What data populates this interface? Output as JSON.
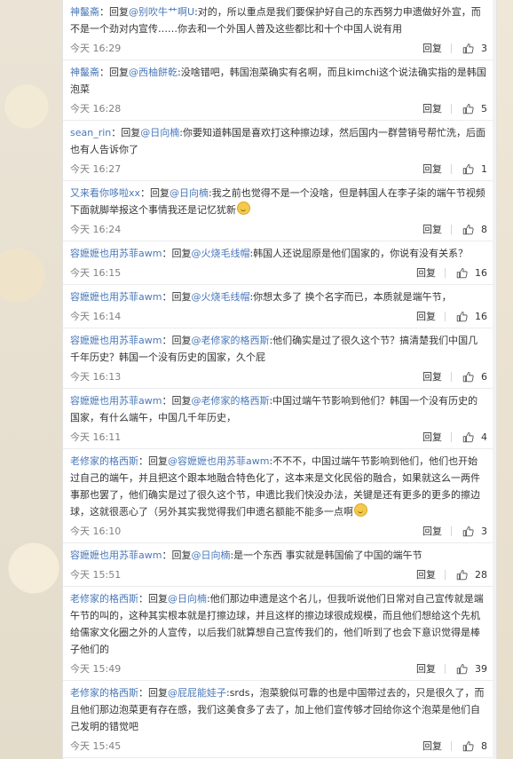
{
  "colors": {
    "username": "#4a78b8",
    "text": "#333333",
    "time": "#808080",
    "background": "#e9e4da"
  },
  "reply_label": "回复",
  "like_icon": "thumbs-up-icon",
  "comments": [
    {
      "user": "神鬣斋",
      "prefix": "：回复",
      "mention": "@别吹牛艹啊U",
      "text": ":对的，所以重点是我们要保护好自己的东西努力申遗做好外宣，而不是一个劲对内宣传……你去和一个外国人普及这些都比和十个中国人说有用",
      "time": "今天 16:29",
      "likes": "3"
    },
    {
      "user": "神鬣斋",
      "prefix": "：回复",
      "mention": "@西柚餅乾",
      "text": ":没啥错吧，韩国泡菜确实有名啊，而且kimchi这个说法确实指的是韩国泡菜",
      "time": "今天 16:28",
      "likes": "5"
    },
    {
      "user": "sean_rin",
      "prefix": "：回复",
      "mention": "@日向楠",
      "text": ":你要知道韩国是喜欢打这种擦边球，然后国内一群营销号帮忙洗，后面也有人告诉你了",
      "time": "今天 16:27",
      "likes": "1"
    },
    {
      "user": "又来看你哆啦xx",
      "prefix": "：回复",
      "mention": "@日向楠",
      "text": ":我之前也觉得不是一个没啥，但是韩国人在李子柒的端午节视频下面就脚举报这个事情我还是记忆犹新",
      "emoji": true,
      "time": "今天 16:24",
      "likes": "8"
    },
    {
      "user": "容嬷嬷也用苏菲awm",
      "prefix": "：回复",
      "mention": "@火烧毛线帽",
      "text": ":韩国人还说屈原是他们国家的，你说有没有关系？",
      "time": "今天 16:15",
      "likes": "16"
    },
    {
      "user": "容嬷嬷也用苏菲awm",
      "prefix": "：回复",
      "mention": "@火烧毛线帽",
      "text": ":你想太多了 换个名字而已，本质就是端午节，",
      "time": "今天 16:14",
      "likes": "16"
    },
    {
      "user": "容嬷嬷也用苏菲awm",
      "prefix": "：回复",
      "mention": "@老修家的格西斯",
      "text": ":他们确实是过了很久这个节？搞清楚我们中国几千年历史？韩国一个没有历史的国家，久个屁",
      "time": "今天 16:13",
      "likes": "6"
    },
    {
      "user": "容嬷嬷也用苏菲awm",
      "prefix": "：回复",
      "mention": "@老修家的格西斯",
      "text": ":中国过端午节影响到他们？韩国一个没有历史的国家，有什么端午，中国几千年历史，",
      "time": "今天 16:11",
      "likes": "4"
    },
    {
      "user": "老修家的格西斯",
      "prefix": "：回复",
      "mention": "@容嬷嬷也用苏菲awm",
      "text": ":不不不，中国过端午节影响到他们，他们也开始过自己的端午，并且把这个跟本地融合特色化了，这本来是文化民俗的融合，如果就这么一两件事那也罢了，他们确实是过了很久这个节，申遗比我们快没办法，关键是还有更多的更多的擦边球，这就很恶心了（另外其实我觉得我们申遗名额能不能多一点啊",
      "emoji": true,
      "time": "今天 16:10",
      "likes": "3"
    },
    {
      "user": "容嬷嬷也用苏菲awm",
      "prefix": "：回复",
      "mention": "@日向楠",
      "text": ":是一个东西 事实就是韩国偷了中国的端午节",
      "time": "今天 15:51",
      "likes": "28"
    },
    {
      "user": "老修家的格西斯",
      "prefix": "：回复",
      "mention": "@日向楠",
      "text": ":他们那边申遗是这个名儿，但我听说他们日常对自己宣传就是端午节的叫的，这种其实根本就是打擦边球，并且这样的擦边球很成规模，而且他们想给这个先机给儒家文化圈之外的人宣传，以后我们就算想自己宣传我们的，他们听到了也会下意识觉得是棒子他们的",
      "time": "今天 15:49",
      "likes": "39"
    },
    {
      "user": "老修家的格西斯",
      "prefix": "：回复",
      "mention": "@屁屁能娃子",
      "text": ":srds，泡菜貌似可靠的也是中国带过去的，只是很久了，而且他们那边泡菜更有存在感，我们这美食多了去了，加上他们宣传够才回给你这个泡菜是他们自己发明的错觉吧",
      "time": "今天 15:45",
      "likes": "8"
    }
  ]
}
